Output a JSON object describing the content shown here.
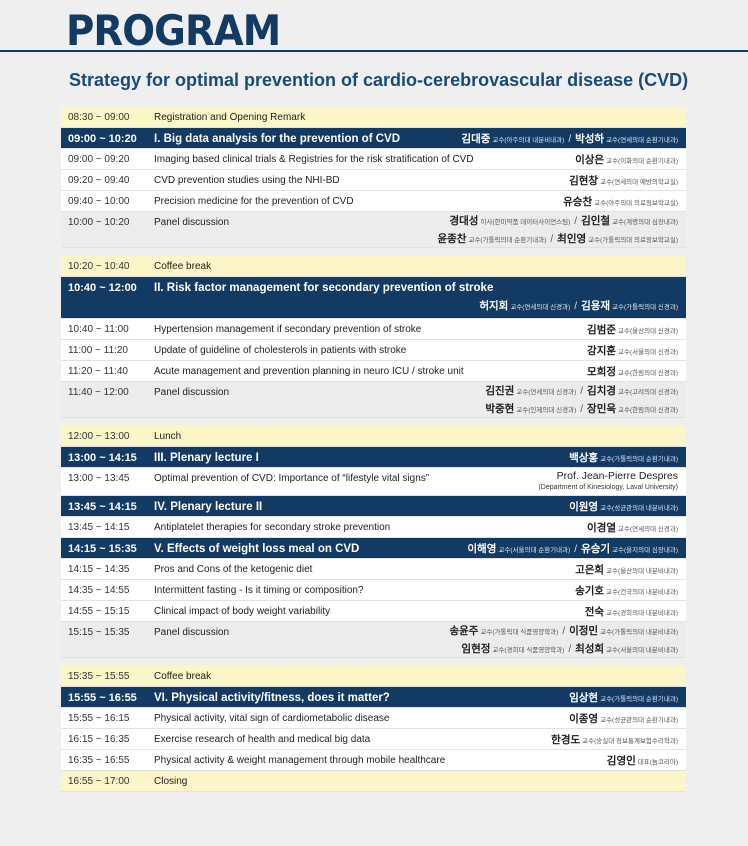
{
  "header": {
    "title": "PROGRAM",
    "subtitle": "Strategy for optimal prevention of cardio-cerebrovascular disease (CVD)"
  },
  "rows": [
    {
      "type": "yellow",
      "time": "08:30 ~ 09:00",
      "title": "Registration and Opening Remark",
      "speakers": []
    },
    {
      "type": "session",
      "time": "09:00 ~ 10:20",
      "title": "I. Big data analysis for the prevention of CVD",
      "speakers": [
        [
          {
            "n": "김대중",
            "a": "교수(아주의대 내분비내과)"
          },
          {
            "n": "박성하",
            "a": "교수(연세의대 순환기내과)"
          }
        ]
      ]
    },
    {
      "type": "white",
      "time": "09:00 ~ 09:20",
      "title": "Imaging based clinical trials & Registries for the risk stratification of CVD",
      "speakers": [
        [
          {
            "n": "이상은",
            "a": "교수(이화의대 순환기내과)"
          }
        ]
      ]
    },
    {
      "type": "white",
      "time": "09:20 ~ 09:40",
      "title": "CVD prevention studies using the NHI-BD",
      "speakers": [
        [
          {
            "n": "김현창",
            "a": "교수(연세의대 예방의학교실)"
          }
        ]
      ]
    },
    {
      "type": "white",
      "time": "09:40 ~ 10:00",
      "title": "Precision medicine for the prevention of CVD",
      "speakers": [
        [
          {
            "n": "유승찬",
            "a": "교수(아주의대 의료정보학교실)"
          }
        ]
      ]
    },
    {
      "type": "grey",
      "time": "10:00 ~ 10:20",
      "title": "Panel discussion",
      "speakers": [
        [
          {
            "n": "경대성",
            "a": "이사(한미약품 데이터사이언스팀)"
          },
          {
            "n": "김인철",
            "a": "교수(계명의대 심장내과)"
          }
        ],
        [
          {
            "n": "윤종찬",
            "a": "교수(가톨릭의대 순환기내과)"
          },
          {
            "n": "최인영",
            "a": "교수(가톨릭의대 의료정보학교실)"
          }
        ]
      ]
    },
    {
      "type": "spacer"
    },
    {
      "type": "yellow",
      "time": "10:20 ~ 10:40",
      "title": "Coffee break",
      "speakers": []
    },
    {
      "type": "session2",
      "time": "10:40 ~ 12:00",
      "title": "II. Risk factor management for secondary prevention of stroke",
      "speakers": [
        [
          {
            "n": "허지회",
            "a": "교수(연세의대 신경과)"
          },
          {
            "n": "김용재",
            "a": "교수(가톨릭의대 신경과)"
          }
        ]
      ]
    },
    {
      "type": "white",
      "time": "10:40 ~ 11:00",
      "title": "Hypertension management if secondary prevention of stroke",
      "speakers": [
        [
          {
            "n": "김범준",
            "a": "교수(울산의대 신경과)"
          }
        ]
      ]
    },
    {
      "type": "white",
      "time": "11:00 ~ 11:20",
      "title": "Update of guideline of cholesterols in patients with stroke",
      "speakers": [
        [
          {
            "n": "강지훈",
            "a": "교수(서울의대 신경과)"
          }
        ]
      ]
    },
    {
      "type": "white",
      "time": "11:20 ~ 11:40",
      "title": "Acute management and prevention planning in neuro ICU / stroke unit",
      "speakers": [
        [
          {
            "n": "모희정",
            "a": "교수(한림의대 신경과)"
          }
        ]
      ]
    },
    {
      "type": "grey",
      "time": "11:40 ~ 12:00",
      "title": "Panel discussion",
      "speakers": [
        [
          {
            "n": "김진권",
            "a": "교수(연세의대 신경과)"
          },
          {
            "n": "김치경",
            "a": "교수(고려의대 신경과)"
          }
        ],
        [
          {
            "n": "박중현",
            "a": "교수(인제의대 신경과)"
          },
          {
            "n": "장민욱",
            "a": "교수(한림의대 신경과)"
          }
        ]
      ]
    },
    {
      "type": "spacer"
    },
    {
      "type": "yellow",
      "time": "12:00 ~ 13:00",
      "title": "Lunch",
      "speakers": []
    },
    {
      "type": "session",
      "time": "13:00 ~ 14:15",
      "title": "III. Plenary lecture I",
      "speakers": [
        [
          {
            "n": "백상홍",
            "a": "교수(가톨릭의대 순환기내과)"
          }
        ]
      ]
    },
    {
      "type": "white-en",
      "time": "13:00 ~ 13:45",
      "title": "Optimal prevention of CVD: Importance of “lifestyle vital signs”",
      "en_name": "Prof. Jean-Pierre Despres",
      "en_affil": "(Department of Kinesiology, Laval University)"
    },
    {
      "type": "session",
      "time": "13:45 ~ 14:15",
      "title": "IV. Plenary lecture II",
      "speakers": [
        [
          {
            "n": "이원영",
            "a": "교수(성균관의대 내분비내과)"
          }
        ]
      ]
    },
    {
      "type": "white",
      "time": "13:45 ~ 14:15",
      "title": "Antiplatelet therapies for secondary stroke prevention",
      "speakers": [
        [
          {
            "n": "이경열",
            "a": "교수(연세의대 신경과)"
          }
        ]
      ]
    },
    {
      "type": "session",
      "time": "14:15 ~ 15:35",
      "title": "V. Effects of weight loss meal on CVD",
      "speakers": [
        [
          {
            "n": "이해영",
            "a": "교수(서울의대 순환기내과)"
          },
          {
            "n": "유승기",
            "a": "교수(을지의대 심장내과)"
          }
        ]
      ]
    },
    {
      "type": "white",
      "time": "14:15 ~ 14:35",
      "title": "Pros and Cons of the ketogenic diet",
      "speakers": [
        [
          {
            "n": "고은희",
            "a": "교수(울산의대 내분비내과)"
          }
        ]
      ]
    },
    {
      "type": "white",
      "time": "14:35 ~ 14:55",
      "title": "Intermittent fasting - Is it timing or composition?",
      "speakers": [
        [
          {
            "n": "송기호",
            "a": "교수(건국의대 내분비내과)"
          }
        ]
      ]
    },
    {
      "type": "white",
      "time": "14:55 ~ 15:15",
      "title": "Clinical impact of body weight variability",
      "speakers": [
        [
          {
            "n": "전숙",
            "a": "교수(경희의대 내분비내과)"
          }
        ]
      ]
    },
    {
      "type": "grey",
      "time": "15:15 ~ 15:35",
      "title": "Panel discussion",
      "speakers": [
        [
          {
            "n": "송윤주",
            "a": "교수(가톨릭대 식품영양학과)"
          },
          {
            "n": "이정민",
            "a": "교수(가톨릭의대 내분비내과)"
          }
        ],
        [
          {
            "n": "임현정",
            "a": "교수(경희대 식품영양학과)"
          },
          {
            "n": "최성희",
            "a": "교수(서울의대 내분비내과)"
          }
        ]
      ]
    },
    {
      "type": "spacer"
    },
    {
      "type": "yellow",
      "time": "15:35 ~ 15:55",
      "title": "Coffee break",
      "speakers": []
    },
    {
      "type": "session",
      "time": "15:55 ~ 16:55",
      "title": "VI. Physical activity/fitness, does it matter?",
      "speakers": [
        [
          {
            "n": "임상현",
            "a": "교수(가톨릭의대 순환기내과)"
          }
        ]
      ]
    },
    {
      "type": "white",
      "time": "15:55 ~ 16:15",
      "title": "Physical activity, vital sign of cardiometabolic disease",
      "speakers": [
        [
          {
            "n": "이종영",
            "a": "교수(성균관의대 순환기내과)"
          }
        ]
      ]
    },
    {
      "type": "white",
      "time": "16:15 ~ 16:35",
      "title": "Exercise research of health and medical big data",
      "speakers": [
        [
          {
            "n": "한경도",
            "a": "교수(숭실대 정보통계보험수리학과)"
          }
        ]
      ]
    },
    {
      "type": "white",
      "time": "16:35 ~ 16:55",
      "title": "Physical activity & weight management through mobile healthcare",
      "speakers": [
        [
          {
            "n": "김영인",
            "a": "대표(눔코리아)"
          }
        ]
      ]
    },
    {
      "type": "yellow",
      "time": "16:55 ~ 17:00",
      "title": "Closing",
      "speakers": []
    }
  ]
}
